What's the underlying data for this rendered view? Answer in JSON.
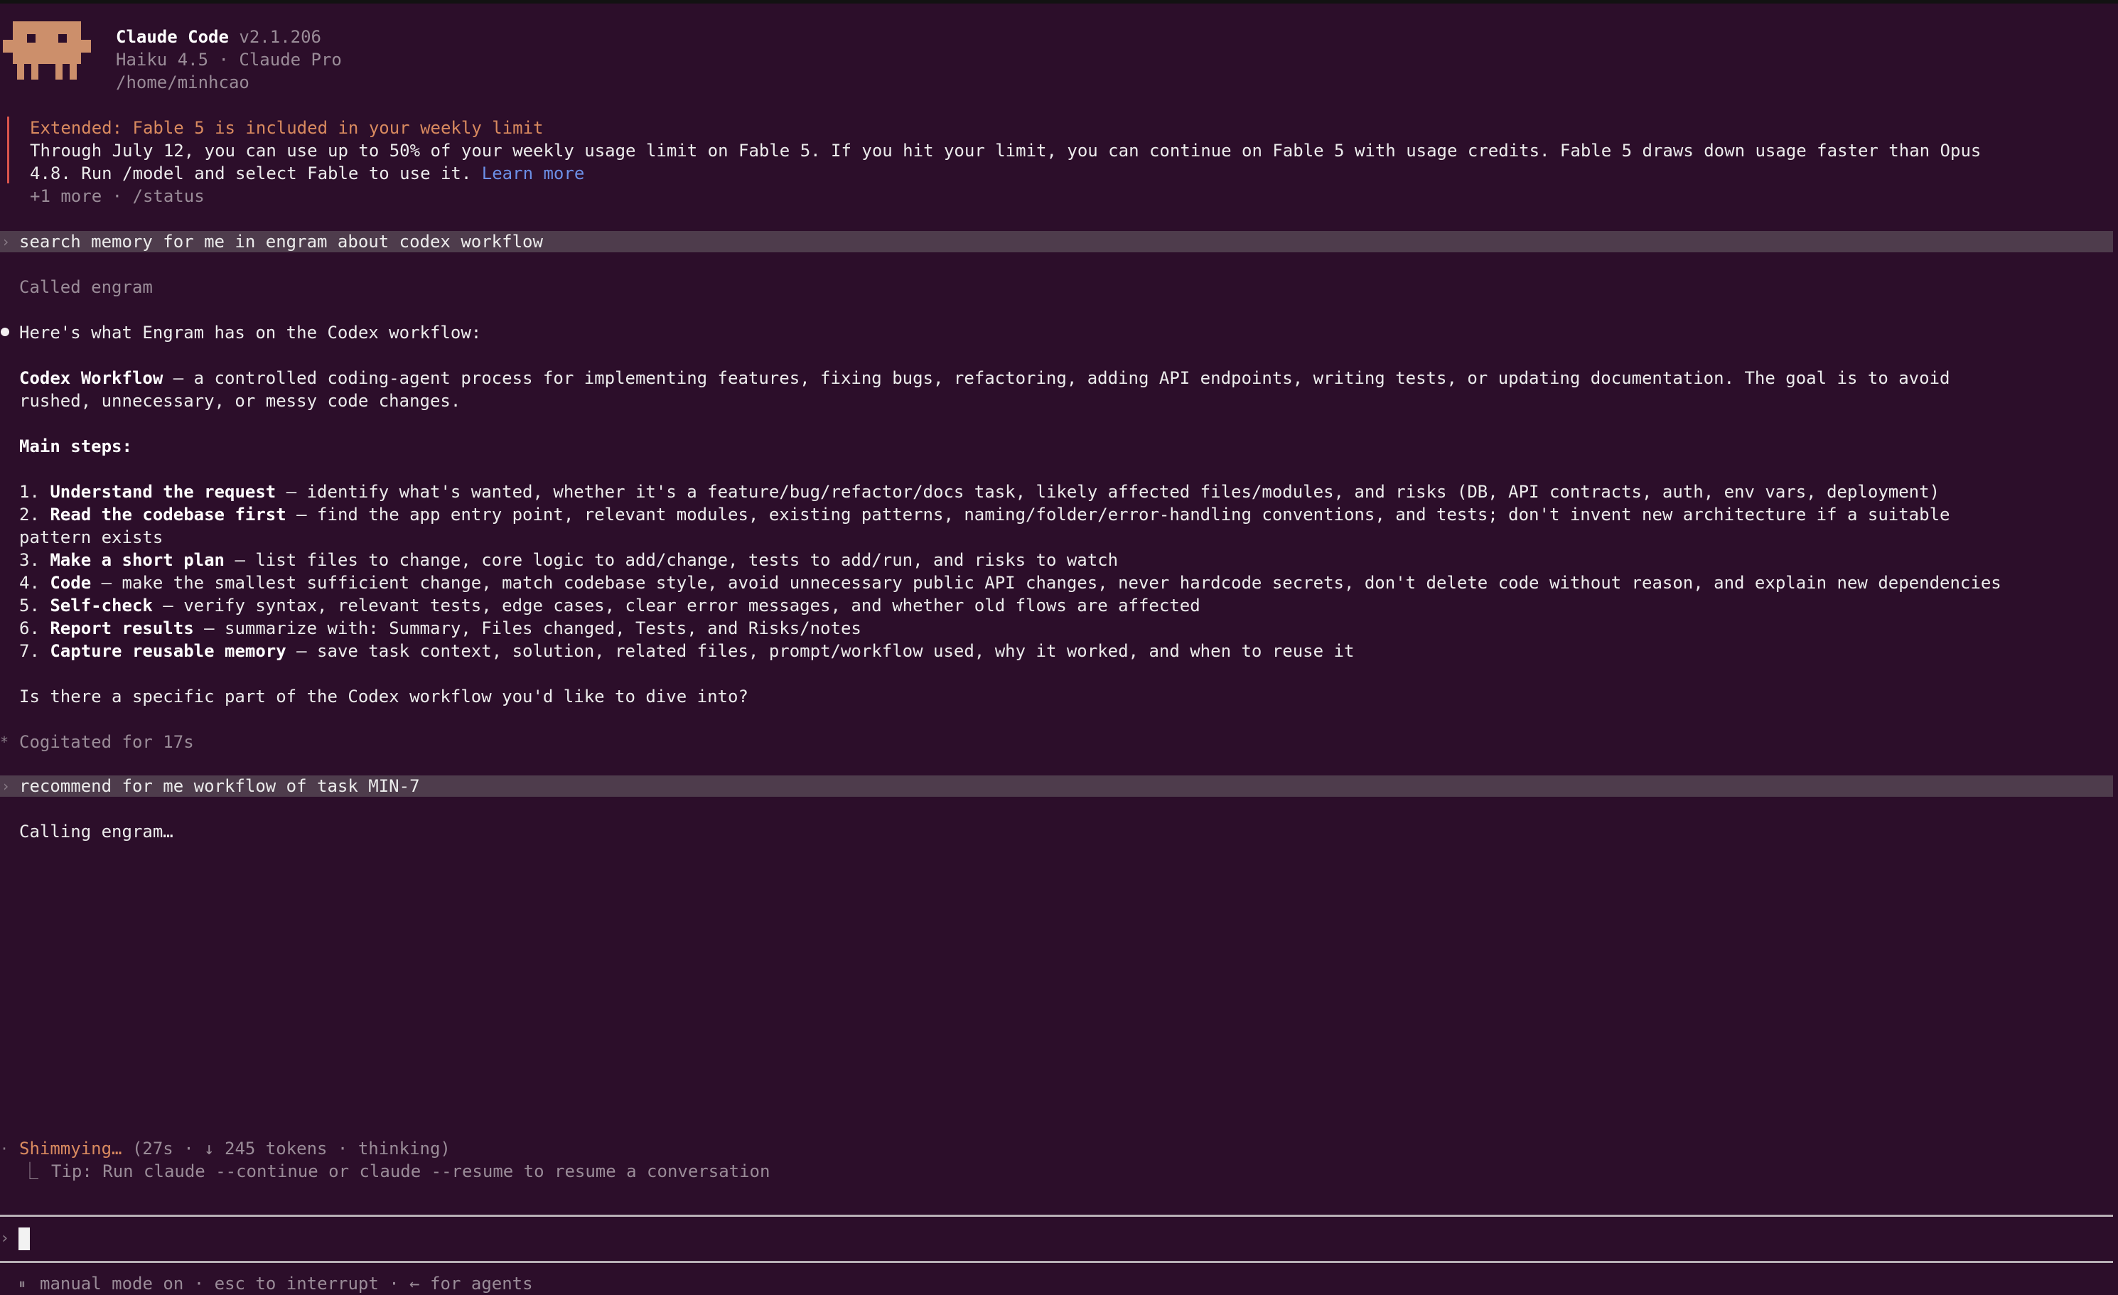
{
  "header": {
    "app_name": "Claude Code",
    "version": "v2.1.206",
    "model_plan": "Haiku 4.5 · Claude Pro",
    "cwd": "/home/minhcao"
  },
  "notice": {
    "title": "Extended: Fable 5 is included in your weekly limit",
    "line1": "Through July 12, you can use up to 50% of your weekly usage limit on Fable 5. If you hit your limit, you can continue on Fable 5 with usage credits. Fable 5 draws down usage faster than Opus",
    "line2": "4.8. Run /model and select Fable to use it.",
    "link": "Learn more",
    "more": "+1 more · /status"
  },
  "conversation": {
    "prompt1": "search memory for me in engram about codex workflow",
    "tool_called": "Called engram",
    "intro": "Here's what Engram has on the Codex workflow:",
    "codex_title": "Codex Workflow",
    "codex_desc1": " — a controlled coding-agent process for implementing features, fixing bugs, refactoring, adding API endpoints, writing tests, or updating documentation. The goal is to avoid",
    "codex_desc2": "rushed, unnecessary, or messy code changes.",
    "main_steps": "Main steps:",
    "steps": [
      {
        "num": "1. ",
        "title": "Understand the request",
        "text": " — identify what's wanted, whether it's a feature/bug/refactor/docs task, likely affected files/modules, and risks (DB, API contracts, auth, env vars, deployment)"
      },
      {
        "num": "2. ",
        "title": "Read the codebase first",
        "text": " — find the app entry point, relevant modules, existing patterns, naming/folder/error-handling conventions, and tests; don't invent new architecture if a suitable",
        "cont": "pattern exists"
      },
      {
        "num": "3. ",
        "title": "Make a short plan",
        "text": " — list files to change, core logic to add/change, tests to add/run, and risks to watch"
      },
      {
        "num": "4. ",
        "title": "Code",
        "text": " — make the smallest sufficient change, match codebase style, avoid unnecessary public API changes, never hardcode secrets, don't delete code without reason, and explain new dependencies"
      },
      {
        "num": "5. ",
        "title": "Self-check",
        "text": " — verify syntax, relevant tests, edge cases, clear error messages, and whether old flows are affected"
      },
      {
        "num": "6. ",
        "title": "Report results",
        "text": " — summarize with: Summary, Files changed, Tests, and Risks/notes"
      },
      {
        "num": "7. ",
        "title": "Capture reusable memory",
        "text": " — save task context, solution, related files, prompt/workflow used, why it worked, and when to reuse it"
      }
    ],
    "question": "Is there a specific part of the Codex workflow you'd like to dive into?",
    "cogitated": "Cogitated for 17s",
    "prompt2": "recommend for me workflow of task MIN-7",
    "calling": "Calling engram…"
  },
  "status": {
    "spinner": "Shimmying…",
    "detail": " (27s · ↓ 245 tokens · thinking)",
    "tip": "Tip: Run claude --continue or claude --resume to resume a conversation"
  },
  "footer": {
    "mode": "manual mode on · esc to interrupt · ← for agents"
  },
  "colors": {
    "background": "#2c0e2a",
    "accent_orange": "#d98a5f",
    "link_blue": "#6c8fe6",
    "prompt_highlight": "#4e3c4c",
    "notice_bar": "#d9544c"
  },
  "icons": {
    "mascot": "claude-code-mascot-icon",
    "prompt_caret": "chevron-right-icon",
    "bullet": "bullet-dot-icon",
    "asterisk": "asterisk-icon"
  }
}
